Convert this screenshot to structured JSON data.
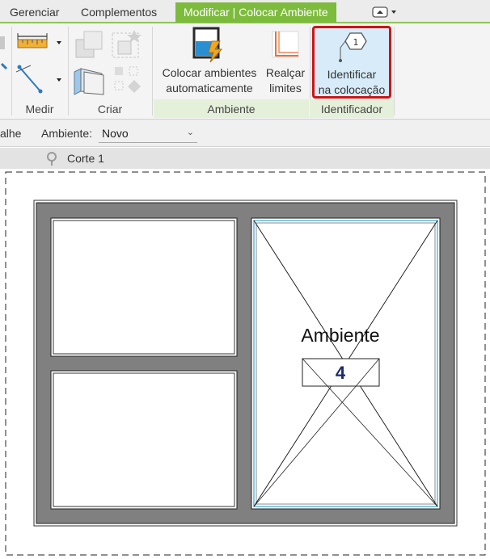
{
  "tabs": [
    {
      "label": "Gerenciar"
    },
    {
      "label": "Complementos"
    },
    {
      "label": "Modificar | Colocar Ambiente"
    }
  ],
  "ribbon": {
    "medir": {
      "label": "Medir"
    },
    "criar": {
      "label": "Criar"
    },
    "ambiente": {
      "label": "Ambiente",
      "auto_place": {
        "line1": "Colocar ambientes",
        "line2": "automaticamente"
      },
      "highlight": {
        "line1": "Realçar",
        "line2": "limites"
      }
    },
    "identificador": {
      "label": "Identificador",
      "tag_on_placement": {
        "line1": "Identificar",
        "line2": "na colocação",
        "icon_number": "1"
      }
    }
  },
  "options_bar": {
    "partial_label": "alhe",
    "ambiente_label": "Ambiente:",
    "ambiente_value": "Novo"
  },
  "view": {
    "name": "Corte 1"
  },
  "drawing": {
    "room_name": "Ambiente",
    "room_number": "4"
  },
  "colors": {
    "accent_green": "#7dbb3c",
    "highlight_red": "#cc1515",
    "wall_gray": "#808080",
    "room_boundary_cyan": "#5ab9e0"
  }
}
